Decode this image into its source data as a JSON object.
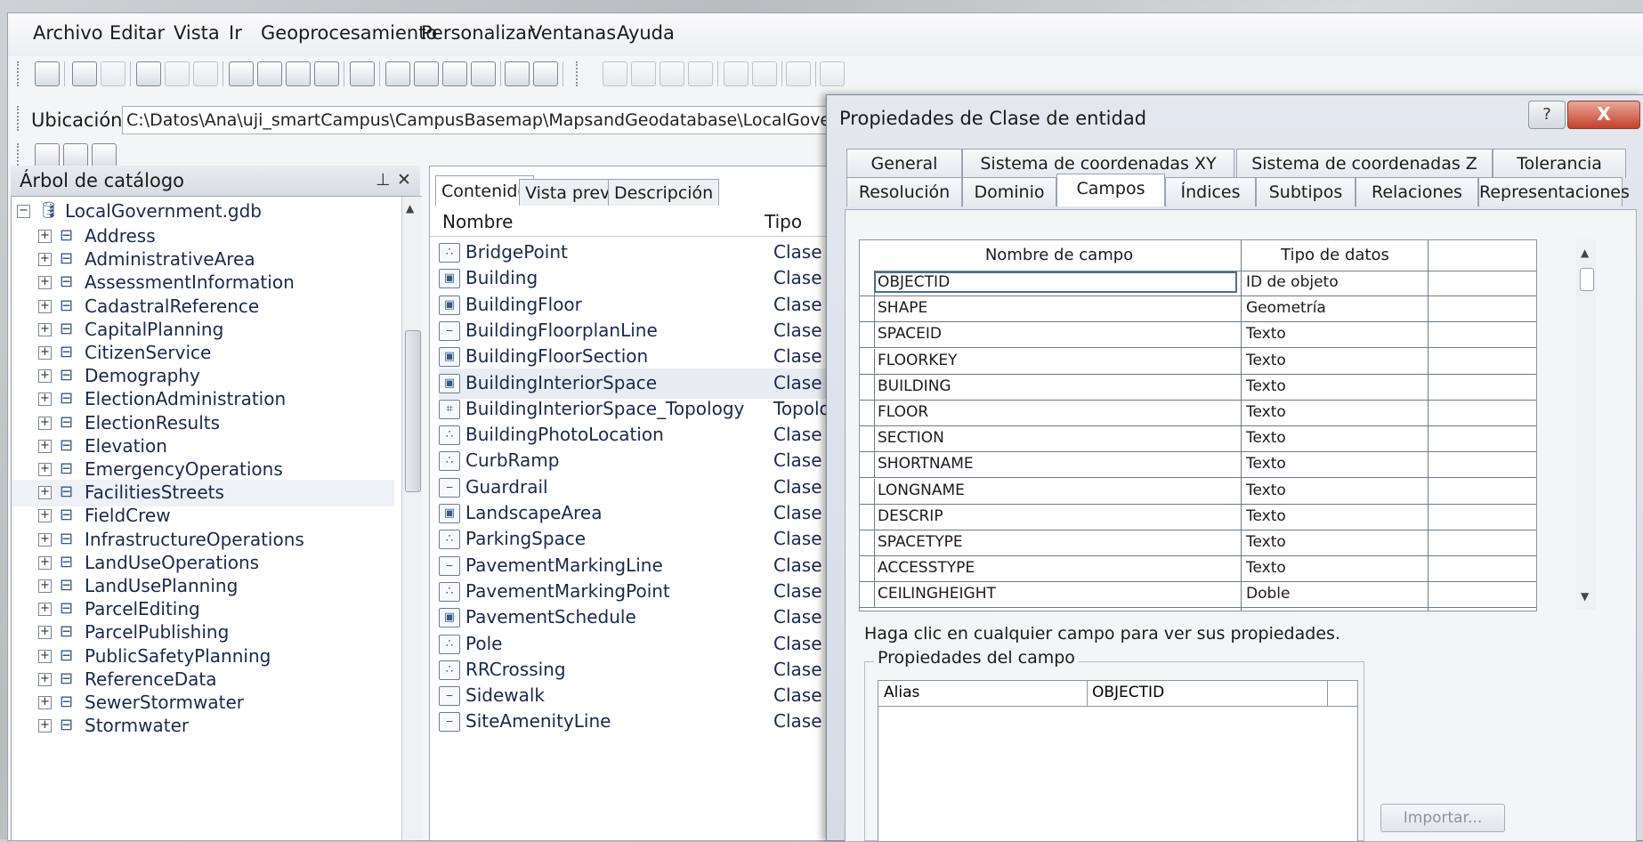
{
  "menu": [
    "Archivo",
    "Editar",
    "Vista",
    "Ir",
    "Geoprocesamiento",
    "Personalizar",
    "Ventanas",
    "Ayuda"
  ],
  "location": {
    "label": "Ubicación:",
    "value": "C:\\Datos\\Ana\\uji_smartCampus\\CampusBasemap\\MapsandGeodatabase\\LocalGovernme"
  },
  "tree": {
    "title": "Árbol de catálogo",
    "root": "LocalGovernment.gdb",
    "items": [
      "Address",
      "AdministrativeArea",
      "AssessmentInformation",
      "CadastralReference",
      "CapitalPlanning",
      "CitizenService",
      "Demography",
      "ElectionAdministration",
      "ElectionResults",
      "Elevation",
      "EmergencyOperations",
      "FacilitiesStreets",
      "FieldCrew",
      "InfrastructureOperations",
      "LandUseOperations",
      "LandUsePlanning",
      "ParcelEditing",
      "ParcelPublishing",
      "PublicSafetyPlanning",
      "ReferenceData",
      "SewerStormwater",
      "Stormwater"
    ]
  },
  "content": {
    "tabs": [
      "Contenido",
      "Vista previa",
      "Descripción"
    ],
    "col_name": "Nombre",
    "col_type": "Tipo",
    "rows": [
      {
        "name": "BridgePoint",
        "type": "Clase d",
        "icon": "point"
      },
      {
        "name": "Building",
        "type": "Clase d",
        "icon": "polygon"
      },
      {
        "name": "BuildingFloor",
        "type": "Clase d",
        "icon": "polygon"
      },
      {
        "name": "BuildingFloorplanLine",
        "type": "Clase d",
        "icon": "line"
      },
      {
        "name": "BuildingFloorSection",
        "type": "Clase d",
        "icon": "polygon"
      },
      {
        "name": "BuildingInteriorSpace",
        "type": "Clase d",
        "icon": "polygon"
      },
      {
        "name": "BuildingInteriorSpace_Topology",
        "type": "Topolo",
        "icon": "topology"
      },
      {
        "name": "BuildingPhotoLocation",
        "type": "Clase d",
        "icon": "point"
      },
      {
        "name": "CurbRamp",
        "type": "Clase d",
        "icon": "point"
      },
      {
        "name": "Guardrail",
        "type": "Clase d",
        "icon": "line"
      },
      {
        "name": "LandscapeArea",
        "type": "Clase d",
        "icon": "polygon"
      },
      {
        "name": "ParkingSpace",
        "type": "Clase d",
        "icon": "point"
      },
      {
        "name": "PavementMarkingLine",
        "type": "Clase d",
        "icon": "line"
      },
      {
        "name": "PavementMarkingPoint",
        "type": "Clase d",
        "icon": "point"
      },
      {
        "name": "PavementSchedule",
        "type": "Clase d",
        "icon": "polygon"
      },
      {
        "name": "Pole",
        "type": "Clase d",
        "icon": "point"
      },
      {
        "name": "RRCrossing",
        "type": "Clase d",
        "icon": "point"
      },
      {
        "name": "Sidewalk",
        "type": "Clase d",
        "icon": "line"
      },
      {
        "name": "SiteAmenityLine",
        "type": "Clase d",
        "icon": "line"
      }
    ]
  },
  "dialog": {
    "title": "Propiedades de Clase de entidad",
    "help": "?",
    "close": "X",
    "tabs_top": [
      "General",
      "Sistema de coordenadas XY",
      "Sistema de coordenadas Z",
      "Tolerancia"
    ],
    "tabs_bottom": [
      "Resolución",
      "Dominio",
      "Campos",
      "Índices",
      "Subtipos",
      "Relaciones",
      "Representaciones"
    ],
    "grid_head_name": "Nombre de campo",
    "grid_head_type": "Tipo de datos",
    "fields": [
      {
        "name": "OBJECTID",
        "type": "ID de objeto"
      },
      {
        "name": "SHAPE",
        "type": "Geometría"
      },
      {
        "name": "SPACEID",
        "type": "Texto"
      },
      {
        "name": "FLOORKEY",
        "type": "Texto"
      },
      {
        "name": "BUILDING",
        "type": "Texto"
      },
      {
        "name": "FLOOR",
        "type": "Texto"
      },
      {
        "name": "SECTION",
        "type": "Texto"
      },
      {
        "name": "SHORTNAME",
        "type": "Texto"
      },
      {
        "name": "LONGNAME",
        "type": "Texto"
      },
      {
        "name": "DESCRIP",
        "type": "Texto"
      },
      {
        "name": "SPACETYPE",
        "type": "Texto"
      },
      {
        "name": "ACCESSTYPE",
        "type": "Texto"
      },
      {
        "name": "CEILINGHEIGHT",
        "type": "Doble"
      }
    ],
    "hint": "Haga clic en cualquier campo para ver sus propiedades.",
    "props_label": "Propiedades del campo",
    "prop_name": "Alias",
    "prop_value": "OBJECTID",
    "import": "Importar..."
  }
}
